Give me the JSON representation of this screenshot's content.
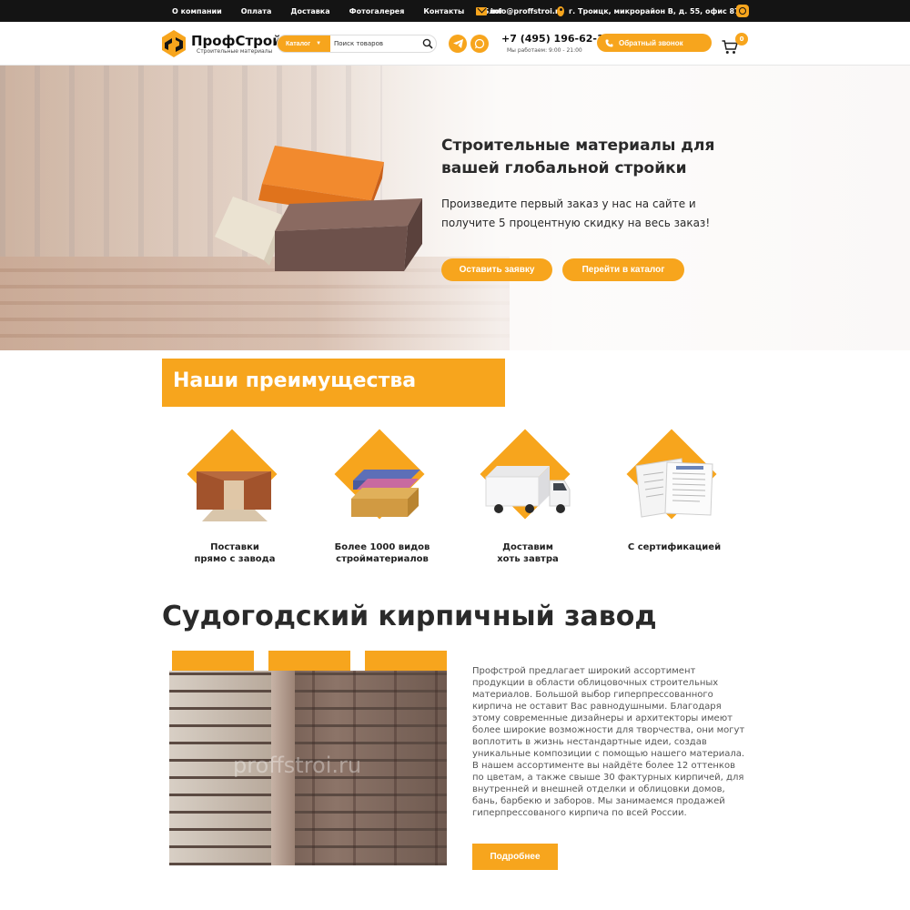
{
  "topbar": {
    "nav": [
      "О компании",
      "Оплата",
      "Доставка",
      "Фотогалерея",
      "Контакты",
      "Блог"
    ],
    "email": "info@proffstroi.ru",
    "address": "г. Троицк, микрорайон В, д. 55, офис 87",
    "social_icon": "instagram-icon"
  },
  "header": {
    "logo_name": "ПрофСтрой",
    "logo_sub": "Строительные материалы",
    "catalog_label": "Каталог",
    "search_placeholder": "Поиск товаров",
    "phone": "+7 (495) 196-62-15",
    "hours": "Мы работаем: 9:00 - 21:00",
    "callback_label": "Обратный звонок",
    "cart_count": "0"
  },
  "hero": {
    "title": "Строительные материалы для вашей глобальной стройки",
    "text": "Произведите первый заказ у нас на сайте и получите 5 процентную скидку на весь заказ!",
    "btn_request": "Оставить заявку",
    "btn_catalog": "Перейти в каталог"
  },
  "advantages": {
    "title": "Наши преимущества",
    "items": [
      {
        "label": "Поставки\nпрямо с завода",
        "icon": "factory-icon"
      },
      {
        "label": "Более 1000 видов\nстройматериалов",
        "icon": "bricks-icon"
      },
      {
        "label": "Доставим\nхоть завтра",
        "icon": "truck-icon"
      },
      {
        "label": "С сертификацией",
        "icon": "certificate-icon"
      }
    ]
  },
  "factory": {
    "title": "Судогодский кирпичный завод",
    "watermark": "proffstroi.ru",
    "text": "Профстрой предлагает широкий ассортимент продукции в области облицовочных строительных материалов. Большой выбор гиперпрессованного кирпича не оставит Вас равнодушными. Благодаря этому современные дизайнеры и архитекторы имеют более широкие возможности для творчества, они могут воплотить в жизнь нестандартные идеи, создав уникальные композиции с помощью нашего материала. В нашем ассортименте вы найдёте более 12 оттенков по цветам, а также свыше 30 фактурных кирпичей, для внутренней и внешней отделки и облицовки домов, бань, барбекю и заборов. Мы занимаемся продажей гиперпрессованого кирпича по всей России.",
    "more_label": "Подробнее"
  },
  "colors": {
    "accent": "#f7a51d",
    "dark": "#141414"
  }
}
